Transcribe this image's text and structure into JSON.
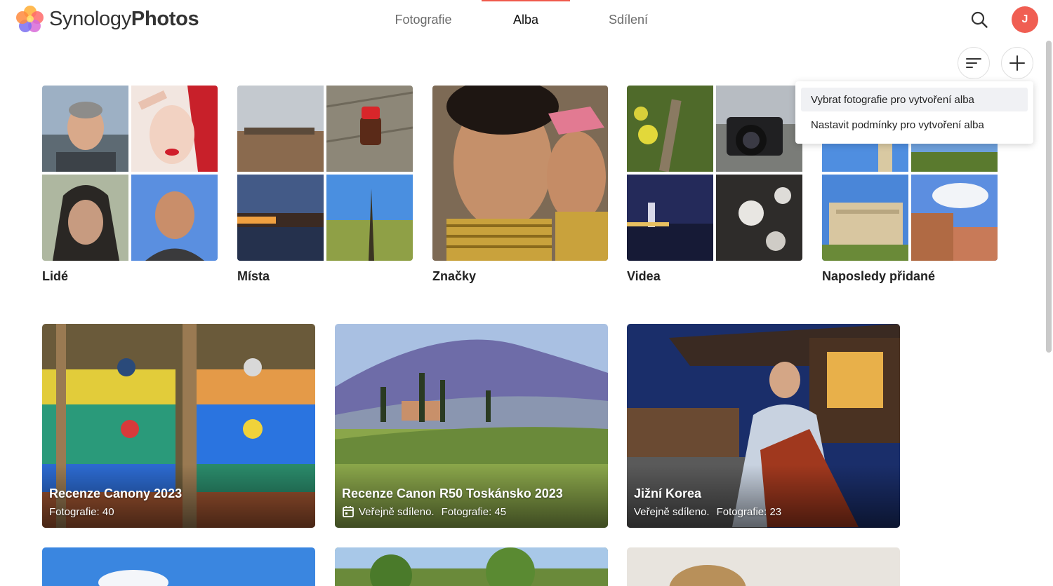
{
  "app": {
    "logo_light": "Synology",
    "logo_bold": "Photos",
    "logo_icon": "synology-photos-flower-logo"
  },
  "nav": {
    "tabs": [
      {
        "label": "Fotografie",
        "active": false
      },
      {
        "label": "Alba",
        "active": true
      },
      {
        "label": "Sdílení",
        "active": false
      }
    ],
    "active_color": "#ef5a4c"
  },
  "header": {
    "search_icon": "search-icon",
    "avatar_initial": "J",
    "avatar_color": "#f05e52"
  },
  "toolbar": {
    "sort_icon": "sort-icon",
    "add_icon": "plus-icon"
  },
  "dropdown": {
    "items": [
      {
        "label": "Vybrat fotografie pro vytvoření alba"
      },
      {
        "label": "Nastavit podmínky pro vytvoření alba"
      }
    ]
  },
  "smart_albums": [
    {
      "label": "Lidé"
    },
    {
      "label": "Místa"
    },
    {
      "label": "Značky"
    },
    {
      "label": "Videa"
    },
    {
      "label": "Naposledy přidané"
    }
  ],
  "albums": [
    {
      "title": "Recenze Canony 2023",
      "shared": "",
      "count": "Fotografie: 40"
    },
    {
      "title": "Recenze Canon R50 Toskánsko 2023",
      "shared": "Veřejně sdíleno.",
      "count": "Fotografie: 45"
    },
    {
      "title": "Jižní Korea",
      "shared": "Veřejně sdíleno.",
      "count": "Fotografie: 23"
    }
  ]
}
